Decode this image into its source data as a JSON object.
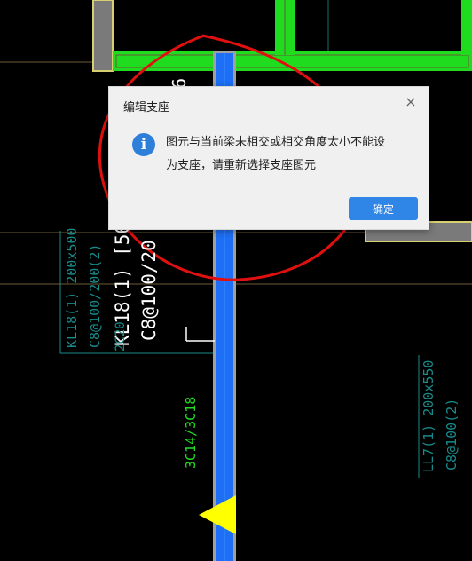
{
  "dialog": {
    "title": "编辑支座",
    "close_glyph": "×",
    "info_glyph": "i",
    "message_line1": "图元与当前梁未相交或相交角度太小不能设",
    "message_line2": "为支座，请重新选择支座图元",
    "ok_label": "确定"
  },
  "drawing": {
    "label_kl18_main": "KL18(1) [56",
    "label_c8_main": "C8@100/20",
    "label_kl18_small": "KL18(1) 200x500",
    "label_c8_small": "C8@100/200(2)",
    "label_cut": "2C20",
    "label_3c14": "3C14/3C18",
    "label_ll7": "LL7(1) 200x550",
    "label_ll7_c8": "C8@100(2)",
    "label_top_digit": "6"
  },
  "colors": {
    "green_beam": "#1fdc1f",
    "blue_beam": "#1e6ff5",
    "red_annotation": "#e01010",
    "dialog_button": "#2f86e6",
    "info_icon": "#2e7fd9"
  }
}
